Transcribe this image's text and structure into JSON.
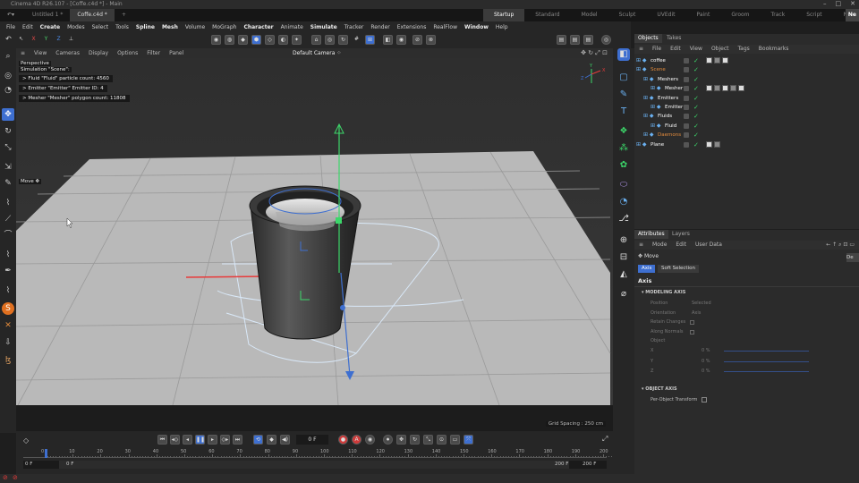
{
  "window": {
    "title": "Cinema 4D R26.107 - [Coffe.c4d *] - Main"
  },
  "doc_tabs": [
    {
      "label": "Untitled 1 *",
      "active": false
    },
    {
      "label": "Coffe.c4d *",
      "active": true
    }
  ],
  "layouts": [
    "Startup",
    "Standard",
    "Model",
    "Sculpt",
    "UVEdit",
    "Paint",
    "Groom",
    "Track",
    "Script",
    "Nodes"
  ],
  "layout_overflow": "Ne",
  "menu": [
    {
      "label": "File",
      "bold": false
    },
    {
      "label": "Edit",
      "bold": false
    },
    {
      "label": "Create",
      "bold": true
    },
    {
      "label": "Modes",
      "bold": false
    },
    {
      "label": "Select",
      "bold": false
    },
    {
      "label": "Tools",
      "bold": false
    },
    {
      "label": "Spline",
      "bold": true
    },
    {
      "label": "Mesh",
      "bold": true
    },
    {
      "label": "Volume",
      "bold": false
    },
    {
      "label": "MoGraph",
      "bold": false
    },
    {
      "label": "Character",
      "bold": true
    },
    {
      "label": "Animate",
      "bold": false
    },
    {
      "label": "Simulate",
      "bold": true
    },
    {
      "label": "Tracker",
      "bold": false
    },
    {
      "label": "Render",
      "bold": false
    },
    {
      "label": "Extensions",
      "bold": false
    },
    {
      "label": "RealFlow",
      "bold": false
    },
    {
      "label": "Window",
      "bold": true
    },
    {
      "label": "Help",
      "bold": false
    }
  ],
  "viewport_menu": [
    "View",
    "Cameras",
    "Display",
    "Options",
    "Filter",
    "Panel"
  ],
  "viewport": {
    "projection": "Perspective",
    "simulation": "Simulation \"Scene\":",
    "camera": "Default Camera",
    "camera_icon": "dots-icon",
    "hud_lines": [
      "> Fluid \"Fluid\" particle count: 4560",
      "> Emitter \"Emitter\" Emitter ID: 4",
      "> Mesher \"Mesher\" polygon count: 11808"
    ],
    "tool_label": "Move",
    "grid_spacing": "Grid Spacing : 250 cm",
    "axis_x": "X",
    "axis_y": "Y",
    "axis_z": "Z"
  },
  "timeline": {
    "frame_display": "0 F",
    "ticks": [
      "0",
      "10",
      "20",
      "30",
      "40",
      "50",
      "60",
      "70",
      "80",
      "90",
      "100",
      "110",
      "120",
      "130",
      "140",
      "150",
      "160",
      "170",
      "180",
      "190",
      "200"
    ],
    "current": "0",
    "start_field": "0 F",
    "start_field2": "0 F",
    "end_field": "200 F",
    "end_field2": "200 F"
  },
  "object_manager": {
    "tabs": [
      "Objects",
      "Takes"
    ],
    "menu": [
      "File",
      "Edit",
      "View",
      "Object",
      "Tags",
      "Bookmarks"
    ],
    "objects": [
      {
        "name": "coffee",
        "indent": 0,
        "color": "#ffffff",
        "icon": "null-icon",
        "tags": [
          "material-tag",
          "material-tag-2",
          "material-tag-3"
        ]
      },
      {
        "name": "Scene",
        "indent": 0,
        "color": "#e08a3c",
        "icon": "scene-icon",
        "tags": []
      },
      {
        "name": "Meshers",
        "indent": 1,
        "color": "#ffffff",
        "icon": "folder-icon",
        "tags": []
      },
      {
        "name": "Mesher",
        "indent": 2,
        "color": "#ffffff",
        "icon": "mesher-icon",
        "tags": [
          "tag-1",
          "tag-2",
          "tag-3",
          "tag-4",
          "tag-5"
        ]
      },
      {
        "name": "Emitters",
        "indent": 1,
        "color": "#ffffff",
        "icon": "folder-icon",
        "tags": []
      },
      {
        "name": "Emitter",
        "indent": 2,
        "color": "#ffffff",
        "icon": "emitter-icon",
        "tags": []
      },
      {
        "name": "Fluids",
        "indent": 1,
        "color": "#ffffff",
        "icon": "folder-icon",
        "tags": []
      },
      {
        "name": "Fluid",
        "indent": 2,
        "color": "#ffffff",
        "icon": "fluid-icon",
        "tags": []
      },
      {
        "name": "Daemons",
        "indent": 1,
        "color": "#e08a3c",
        "icon": "daemon-icon",
        "tags": []
      },
      {
        "name": "Plane",
        "indent": 0,
        "color": "#ffffff",
        "icon": "plane-icon",
        "tags": [
          "tag-a",
          "tag-b"
        ]
      }
    ]
  },
  "attributes": {
    "tabs": [
      "Attributes",
      "Layers"
    ],
    "menu": [
      "Mode",
      "Edit",
      "User Data"
    ],
    "tool": "Move",
    "tool_right": "De",
    "subtabs": [
      {
        "label": "Axis",
        "active": true
      },
      {
        "label": "Soft Selection",
        "active": false
      }
    ],
    "heading": "Axis",
    "sections": [
      {
        "title": "MODELING AXIS",
        "rows": [
          {
            "label": "Position",
            "value": "Selected"
          },
          {
            "label": "Orientation",
            "value": "Axis"
          },
          {
            "label": "Retain Changes",
            "value": ""
          },
          {
            "label": "Along Normals",
            "value": ""
          },
          {
            "label": "Object",
            "value": ""
          },
          {
            "label": "X",
            "value": "0 %"
          },
          {
            "label": "Y",
            "value": "0 %"
          },
          {
            "label": "Z",
            "value": "0 %"
          }
        ]
      },
      {
        "title": "OBJECT AXIS",
        "rows": [
          {
            "label": "Per-Object Transform",
            "value": ""
          }
        ]
      }
    ]
  },
  "colors": {
    "accent": "#3e6fd0",
    "check": "#3cd76a",
    "x_axis": "#e83a3a",
    "y_axis": "#3cd76a",
    "z_axis": "#3e6fd0",
    "orange": "#e08a3c"
  }
}
